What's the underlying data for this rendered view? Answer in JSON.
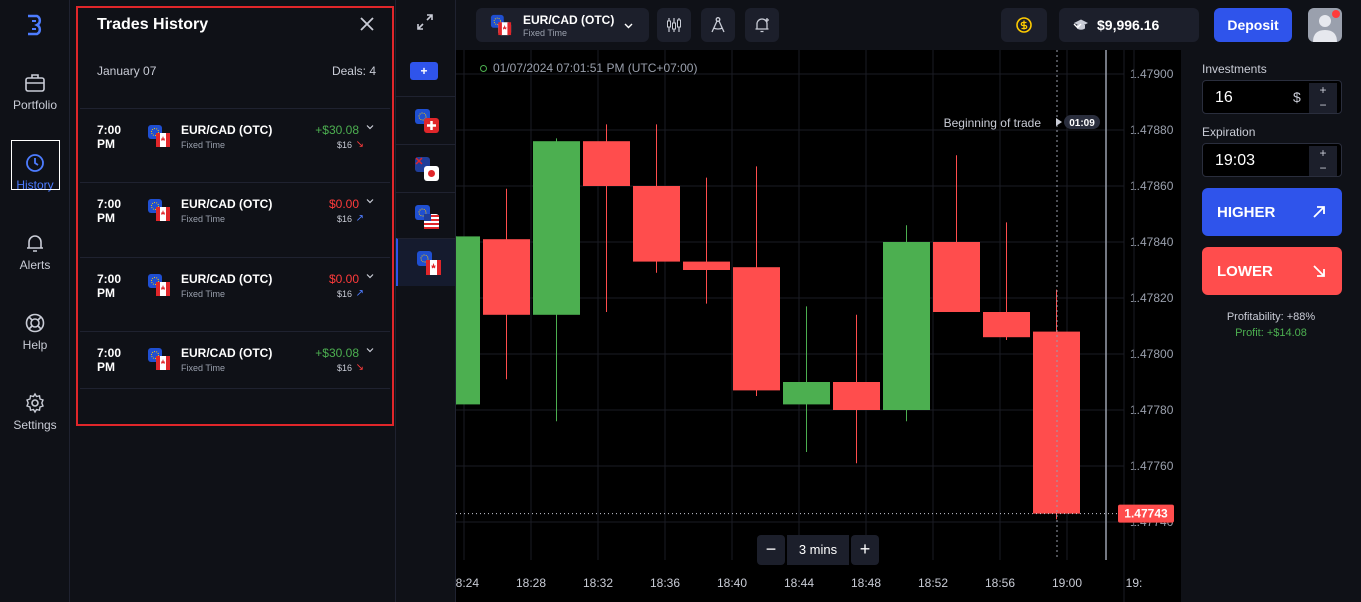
{
  "nav": {
    "items": [
      {
        "label": "Portfolio",
        "icon": "briefcase-icon"
      },
      {
        "label": "History",
        "icon": "history-icon"
      },
      {
        "label": "Alerts",
        "icon": "bell-icon"
      },
      {
        "label": "Help",
        "icon": "lifebuoy-icon"
      },
      {
        "label": "Settings",
        "icon": "gear-icon"
      }
    ],
    "active": "History"
  },
  "panel": {
    "title": "Trades History",
    "date": "January 07",
    "deals": "Deals: 4",
    "trades": [
      {
        "time": "7:00 PM",
        "pair": "EUR/CAD (OTC)",
        "type": "Fixed Time",
        "amount": "+$30.08",
        "stake": "$16",
        "result": "win",
        "direction": "down"
      },
      {
        "time": "7:00 PM",
        "pair": "EUR/CAD (OTC)",
        "type": "Fixed Time",
        "amount": "$0.00",
        "stake": "$16",
        "result": "loss",
        "direction": "up"
      },
      {
        "time": "7:00 PM",
        "pair": "EUR/CAD (OTC)",
        "type": "Fixed Time",
        "amount": "$0.00",
        "stake": "$16",
        "result": "loss",
        "direction": "up"
      },
      {
        "time": "7:00 PM",
        "pair": "EUR/CAD (OTC)",
        "type": "Fixed Time",
        "amount": "+$30.08",
        "stake": "$16",
        "result": "win",
        "direction": "down"
      }
    ]
  },
  "assets": {
    "add_label": "+",
    "tabs": [
      "EUR/CHF",
      "AUD/JPY",
      "EUR/USD",
      "EUR/CAD"
    ]
  },
  "topbar": {
    "asset_name": "EUR/CAD (OTC)",
    "asset_type": "Fixed Time",
    "balance": "$9,996.16",
    "deposit_label": "Deposit"
  },
  "chart": {
    "timestamp": "01/07/2024  07:01:51 PM  (UTC+07:00)",
    "marker_label": "Beginning of trade",
    "marker_time": "01:09",
    "current_price": "1.47743",
    "timeframe": "3 mins",
    "colors": {
      "up": "#4caf50",
      "down": "#ff4d4d"
    }
  },
  "chart_data": {
    "type": "candlestick",
    "title": "",
    "x_ticks": [
      "18:24",
      "18:28",
      "18:32",
      "18:36",
      "18:40",
      "18:44",
      "18:48",
      "18:52",
      "18:56",
      "19:00",
      "19:"
    ],
    "y_ticks": [
      "1.47900",
      "1.47880",
      "1.47860",
      "1.47840",
      "1.47820",
      "1.47800",
      "1.47780",
      "1.47760",
      "1.47740"
    ],
    "ylim": [
      1.4774,
      1.47904
    ],
    "candles": [
      {
        "open": 1.47782,
        "close": 1.47842,
        "high": 1.47842,
        "low": 1.47782
      },
      {
        "open": 1.47841,
        "close": 1.47814,
        "high": 1.47859,
        "low": 1.47791
      },
      {
        "open": 1.47814,
        "close": 1.47876,
        "high": 1.47877,
        "low": 1.47776
      },
      {
        "open": 1.47876,
        "close": 1.4786,
        "high": 1.47882,
        "low": 1.47815
      },
      {
        "open": 1.4786,
        "close": 1.47833,
        "high": 1.47882,
        "low": 1.47829
      },
      {
        "open": 1.47833,
        "close": 1.4783,
        "high": 1.47863,
        "low": 1.47818
      },
      {
        "open": 1.47831,
        "close": 1.47787,
        "high": 1.47867,
        "low": 1.47785
      },
      {
        "open": 1.47782,
        "close": 1.4779,
        "high": 1.47817,
        "low": 1.47765
      },
      {
        "open": 1.4779,
        "close": 1.4778,
        "high": 1.47814,
        "low": 1.47761
      },
      {
        "open": 1.4778,
        "close": 1.4784,
        "high": 1.47846,
        "low": 1.47776
      },
      {
        "open": 1.4784,
        "close": 1.47815,
        "high": 1.47871,
        "low": 1.47815
      },
      {
        "open": 1.47815,
        "close": 1.47806,
        "high": 1.47847,
        "low": 1.47805
      },
      {
        "open": 1.47808,
        "close": 1.47743,
        "high": 1.47823,
        "low": 1.47741
      }
    ]
  },
  "trade_panel": {
    "investments_label": "Investments",
    "investment_value": "16",
    "currency": "$",
    "expiration_label": "Expiration",
    "expiration_value": "19:03",
    "higher_label": "HIGHER",
    "lower_label": "LOWER",
    "profitability": "Profitability: +88%",
    "profit": "Profit: +$14.08"
  }
}
